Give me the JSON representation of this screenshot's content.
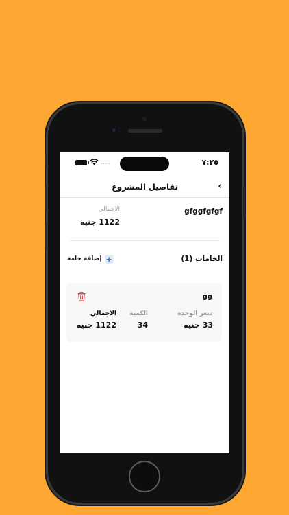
{
  "status_bar": {
    "time": "٧:٢٥",
    "signal": "....",
    "icons": [
      "battery-icon",
      "wifi-icon"
    ]
  },
  "header": {
    "title": "تفاصيل المشروع",
    "back_icon": "‹"
  },
  "project": {
    "name": "gfggfgfgf",
    "total_label": "الاجمالي",
    "total_value": "1122 جنيه"
  },
  "materials": {
    "title": "الخامات (1)",
    "add_label": "إضافة خامة",
    "add_icon": "+",
    "items": [
      {
        "name": "gg",
        "unit_price_label": "سعر الوحدة",
        "unit_price_value": "33 جنيه",
        "quantity_label": "الكمية",
        "quantity_value": "34",
        "total_label": "الاجمالي",
        "total_value": "1122 جنيه"
      }
    ]
  },
  "colors": {
    "background": "#FFA733",
    "accent": "#2F6FD6",
    "delete": "#E23B3B"
  }
}
